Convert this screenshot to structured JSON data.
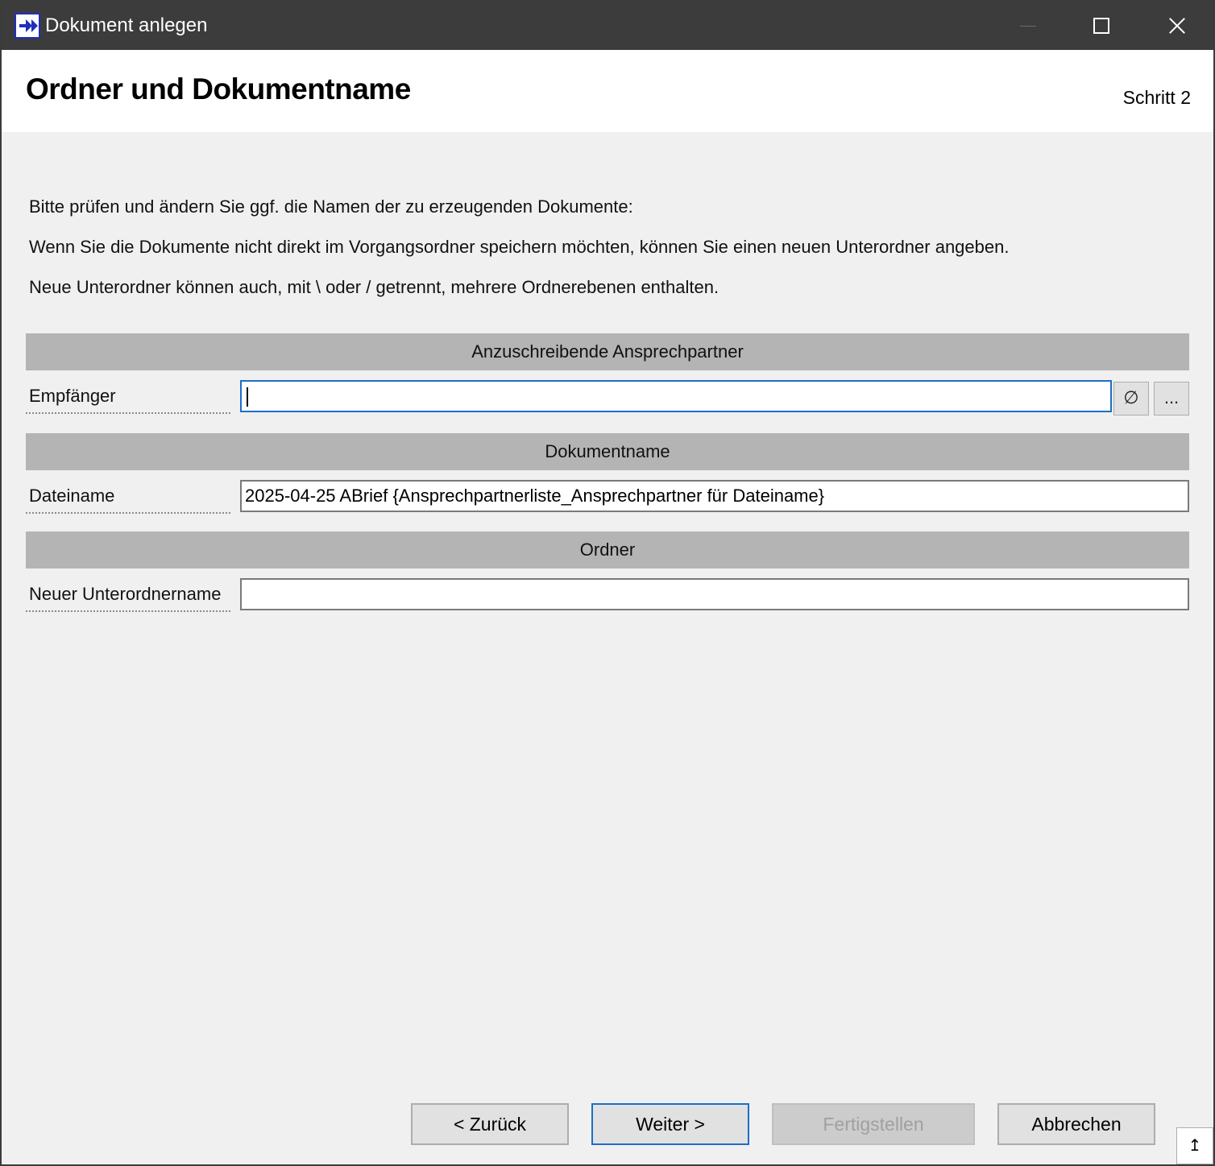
{
  "window": {
    "title": "Dokument anlegen",
    "icon": "app-forward-arrows-icon",
    "controls": [
      "minimize-icon",
      "maximize-icon",
      "close-icon"
    ]
  },
  "header": {
    "title": "Ordner und Dokumentname",
    "step": "Schritt 2"
  },
  "intro": {
    "line1": "Bitte prüfen und ändern Sie ggf. die Namen der zu erzeugenden Dokumente:",
    "line2": "Wenn Sie die Dokumente nicht direkt im Vorgangsordner speichern möchten, können Sie einen neuen Unterordner angeben.",
    "line3": "Neue Unterordner können auch, mit \\ oder / getrennt, mehrere Ordnerebenen enthalten."
  },
  "sections": {
    "recipients": {
      "header": "Anzuschreibende Ansprechpartner",
      "label": "Empfänger",
      "value": "",
      "clear_glyph": "∅",
      "browse_glyph": "..."
    },
    "document": {
      "header": "Dokumentname",
      "label": "Dateiname",
      "value": "2025-04-25 ABrief {Ansprechpartnerliste_Ansprechpartner für Dateiname}"
    },
    "folder": {
      "header": "Ordner",
      "label": "Neuer Unterordnername",
      "value": ""
    }
  },
  "buttons": {
    "back": "< Zurück",
    "next": "Weiter >",
    "finish": "Fertigstellen",
    "cancel": "Abbrechen"
  },
  "colors": {
    "titlebar": "#3c3c3c",
    "section_header": "#b4b4b4",
    "focus": "#1b6fc7",
    "background": "#f0f0f0"
  }
}
